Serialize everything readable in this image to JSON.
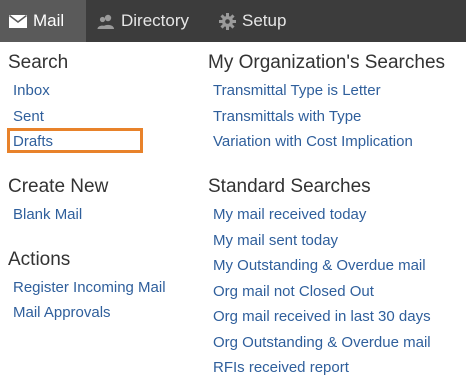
{
  "topbar": {
    "tabs": [
      {
        "label": "Mail",
        "icon": "envelope-icon",
        "active": true
      },
      {
        "label": "Directory",
        "icon": "people-icon",
        "active": false
      },
      {
        "label": "Setup",
        "icon": "gear-icon",
        "active": false
      }
    ]
  },
  "left": {
    "search": {
      "heading": "Search",
      "items": [
        "Inbox",
        "Sent",
        "Drafts"
      ]
    },
    "create_new": {
      "heading": "Create New",
      "items": [
        "Blank Mail"
      ]
    },
    "actions": {
      "heading": "Actions",
      "items": [
        "Register Incoming Mail",
        "Mail Approvals"
      ]
    }
  },
  "right": {
    "org_searches": {
      "heading": "My Organization's Searches",
      "items": [
        "Transmittal Type is Letter",
        "Transmittals with Type",
        "Variation with Cost Implication"
      ]
    },
    "standard_searches": {
      "heading": "Standard Searches",
      "items": [
        "My mail received today",
        "My mail sent today",
        "My Outstanding & Overdue mail",
        "Org mail not Closed Out",
        "Org mail received in last 30 days",
        "Org Outstanding & Overdue mail",
        "RFIs received report"
      ]
    }
  },
  "colors": {
    "topbar_bg": "#3c3c3c",
    "active_tab_bg": "#5a5a5a",
    "link": "#2f5f9c",
    "highlight": "#e8822a"
  }
}
